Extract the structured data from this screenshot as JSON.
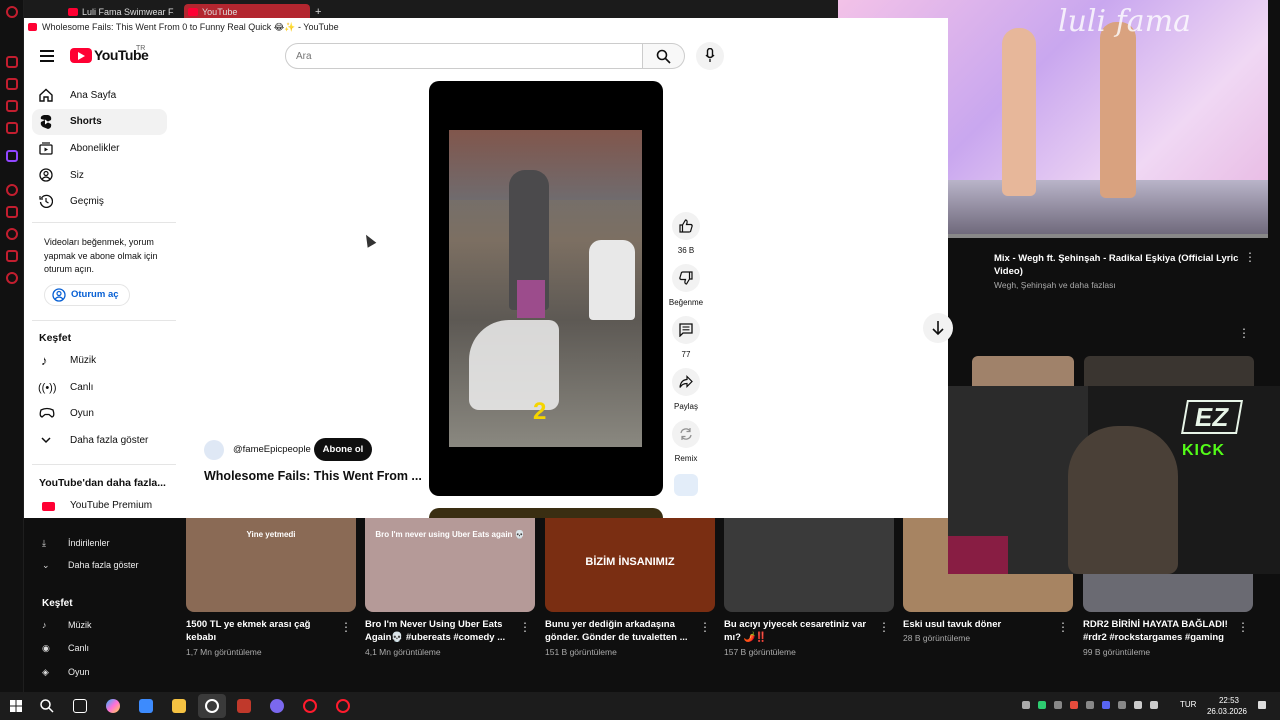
{
  "tabs": [
    {
      "label": "Luli Fama Swimwear Fash"
    },
    {
      "label": "YouTube"
    }
  ],
  "window_title": "Wholesome Fails: This Went From 0 to Funny Real Quick 😂✨ - YouTube",
  "header": {
    "logo": "YouTube",
    "logo_region": "TR",
    "search_placeholder": "Ara"
  },
  "sidebar": {
    "items": [
      {
        "label": "Ana Sayfa",
        "icon": "home-icon"
      },
      {
        "label": "Shorts",
        "icon": "shorts-icon"
      },
      {
        "label": "Abonelikler",
        "icon": "subscriptions-icon"
      },
      {
        "label": "Siz",
        "icon": "user-icon"
      },
      {
        "label": "Geçmiş",
        "icon": "history-icon"
      }
    ],
    "signin_prompt": "Videoları beğenmek, yorum yapmak ve abone olmak için oturum açın.",
    "signin_button": "Oturum aç",
    "explore_title": "Keşfet",
    "explore_items": [
      {
        "label": "Müzik",
        "icon": "music-icon"
      },
      {
        "label": "Canlı",
        "icon": "live-icon"
      },
      {
        "label": "Oyun",
        "icon": "gaming-icon"
      },
      {
        "label": "Daha fazla göster",
        "icon": "chevron-down-icon"
      }
    ],
    "more_title": "YouTube'dan daha fazla...",
    "premium": "YouTube Premium"
  },
  "short": {
    "channel": "@fameEpicpeople",
    "subscribe": "Abone ol",
    "title": "Wholesome Fails: This Went From ...",
    "overlay_number": "2",
    "actions": {
      "like_count": "36 B",
      "dislike_label": "Beğenme",
      "comment_count": "77",
      "share_label": "Paylaş",
      "remix_label": "Remix"
    }
  },
  "pip_right": {
    "title": "Mix - Wegh ft. Şehinşah - Radikal Eşkiya (Official Lyric Video)",
    "meta": "Wegh, Şehinşah ve daha fazlası"
  },
  "bg_sidebar": {
    "items": [
      "İndirilenler",
      "Daha fazla göster"
    ],
    "explore_title": "Keşfet",
    "explore_items": [
      "Müzik",
      "Canlı",
      "Oyun"
    ]
  },
  "cards": [
    {
      "title": "1500 TL ye ekmek arası çağ kebabı",
      "meta": "1,7 Mn görüntüleme",
      "overlay": "Yine yetmedi",
      "color": "#8a6a55"
    },
    {
      "title": "Bro I'm Never Using Uber Eats Again💀 #ubereats #comedy ...",
      "meta": "4,1 Mn görüntüleme",
      "overlay": "Bro I'm never using Uber Eats again 💀",
      "color": "#b59a98"
    },
    {
      "title": "Bunu yer dediğin arkadaşına gönder. Gönder de tuvaletten ...",
      "meta": "151 B görüntüleme",
      "overlay": "BİZİM İNSANIMIZ",
      "color": "#7a2e12"
    },
    {
      "title": "Bu acıyı yiyecek cesaretiniz var mı? 🌶️‼️",
      "meta": "157 B görüntüleme",
      "overlay": "",
      "color": "#3a3a3a"
    },
    {
      "title": "Eski usul tavuk döner",
      "meta": "28 B görüntüleme",
      "overlay": "",
      "color": "#a78462"
    },
    {
      "title": "RDR2 BİRİNİ HAYATA BAĞLADI! #rdr2 #rockstargames #gaming",
      "meta": "99 B görüntüleme",
      "overlay": "",
      "color": "#6a6a72"
    }
  ],
  "stream_overlay": {
    "badge": "EZ",
    "label": "KICK"
  },
  "taskbar": {
    "lang": "TUR",
    "time": "22:53",
    "date": "26.03.2026"
  },
  "colors": {
    "yt_red": "#ff0033",
    "accent_blue": "#065fd4",
    "opera_red": "#c21e2f"
  }
}
